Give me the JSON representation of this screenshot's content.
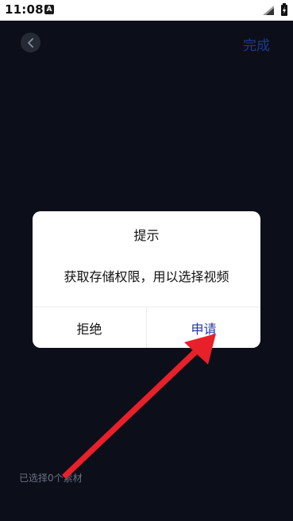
{
  "status_bar": {
    "time": "11:08",
    "app_badge": "A"
  },
  "app_bar": {
    "done_label": "完成"
  },
  "dialog": {
    "title": "提示",
    "message": "获取存储权限，用以选择视频",
    "refuse_label": "拒绝",
    "apply_label": "申请"
  },
  "footer": {
    "selected_text": "已选择0个素材"
  },
  "colors": {
    "background": "#0c0f1a",
    "accent": "#1e3a9a",
    "annotation_red": "#e8202a"
  }
}
